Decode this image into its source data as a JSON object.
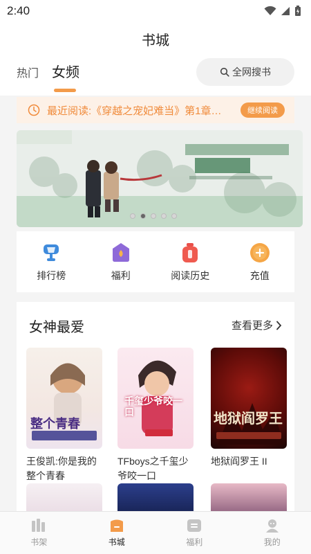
{
  "status_bar": {
    "time": "2:40"
  },
  "header": {
    "title": "书城"
  },
  "tabs": [
    {
      "label": "热门"
    },
    {
      "label": "女频"
    }
  ],
  "search": {
    "label": "全网搜书"
  },
  "recent": {
    "text": "最近阅读:《穿越之宠妃难当》第1章…",
    "button": "继续阅读"
  },
  "banner": {
    "slides": 5,
    "active_index": 1
  },
  "quick_links": [
    {
      "label": "排行榜",
      "icon": "trophy-icon"
    },
    {
      "label": "福利",
      "icon": "gift-icon"
    },
    {
      "label": "阅读历史",
      "icon": "history-icon"
    },
    {
      "label": "充值",
      "icon": "coin-icon"
    }
  ],
  "section": {
    "title": "女神最爱",
    "more": "查看更多",
    "books": [
      {
        "title": "王俊凯:你是我的整个青春",
        "cover_text": "整个青春"
      },
      {
        "title": "TFboys之千玺少爷咬一口",
        "cover_text": "千玺少爷咬一口"
      },
      {
        "title": "地狱阎罗王 II",
        "cover_text": "地狱阎罗王"
      }
    ]
  },
  "bottom_nav": [
    {
      "label": "书架",
      "icon": "bookshelf-icon"
    },
    {
      "label": "书城",
      "icon": "bookstore-icon",
      "active": true
    },
    {
      "label": "福利",
      "icon": "welfare-icon"
    },
    {
      "label": "我的",
      "icon": "profile-icon"
    }
  ],
  "colors": {
    "accent": "#f39b4a",
    "recent_bg": "#fdf1e7",
    "recent_text": "#f08a3a"
  }
}
